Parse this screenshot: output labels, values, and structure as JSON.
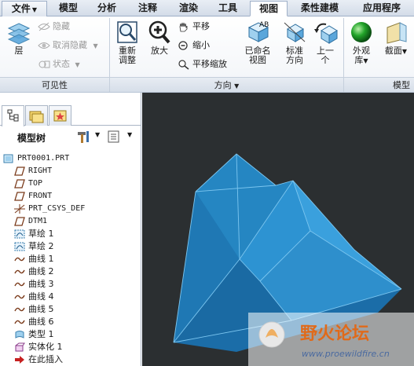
{
  "tabs": {
    "file": "文件",
    "model": "模型",
    "analysis": "分析",
    "annotate": "注释",
    "render": "渲染",
    "tools": "工具",
    "view": "视图",
    "flexible_modeling": "柔性建模",
    "applications": "应用程序"
  },
  "ribbon": {
    "visibility": {
      "layers": "层",
      "hide": "隐藏",
      "unhide": "取消隐藏",
      "status": "状态",
      "group_label": "可见性"
    },
    "orientation": {
      "refit": "重新\n调整",
      "zoom_in": "放大",
      "pan": "平移",
      "zoom_out": "缩小",
      "pan_zoom": "平移缩放",
      "named_views": "已命名\n视图",
      "standard_orientation": "标准\n方向",
      "previous": "上一\n个",
      "group_label": "方向"
    },
    "model_display": {
      "appearance_gallery": "外观\n库",
      "section": "截面",
      "group_label": "模型"
    }
  },
  "panel": {
    "tree_title": "模型树",
    "tree_items": [
      {
        "label": "PRT0001.PRT",
        "icon": "part-icon",
        "mono": true,
        "indent": 0
      },
      {
        "label": "RIGHT",
        "icon": "datum-plane-icon",
        "mono": true,
        "indent": 1
      },
      {
        "label": "TOP",
        "icon": "datum-plane-icon",
        "mono": true,
        "indent": 1
      },
      {
        "label": "FRONT",
        "icon": "datum-plane-icon",
        "mono": true,
        "indent": 1
      },
      {
        "label": "PRT_CSYS_DEF",
        "icon": "csys-icon",
        "mono": true,
        "indent": 1
      },
      {
        "label": "DTM1",
        "icon": "datum-plane-icon",
        "mono": true,
        "indent": 1
      },
      {
        "label": "草绘 1",
        "icon": "sketch-icon",
        "mono": false,
        "indent": 1
      },
      {
        "label": "草绘 2",
        "icon": "sketch-icon",
        "mono": false,
        "indent": 1
      },
      {
        "label": "曲线 1",
        "icon": "curve-icon",
        "mono": false,
        "indent": 1
      },
      {
        "label": "曲线 2",
        "icon": "curve-icon",
        "mono": false,
        "indent": 1
      },
      {
        "label": "曲线 3",
        "icon": "curve-icon",
        "mono": false,
        "indent": 1
      },
      {
        "label": "曲线 4",
        "icon": "curve-icon",
        "mono": false,
        "indent": 1
      },
      {
        "label": "曲线 5",
        "icon": "curve-icon",
        "mono": false,
        "indent": 1
      },
      {
        "label": "曲线 6",
        "icon": "curve-icon",
        "mono": false,
        "indent": 1
      },
      {
        "label": "类型 1",
        "icon": "boundary-blend-icon",
        "mono": false,
        "indent": 1
      },
      {
        "label": "实体化 1",
        "icon": "solidify-icon",
        "mono": false,
        "indent": 1
      },
      {
        "label": "在此插入",
        "icon": "insert-here-arrow-icon",
        "mono": false,
        "indent": 1
      }
    ]
  },
  "watermark": {
    "name": "野火论坛",
    "url": "www.proewildfire.cn"
  },
  "colors": {
    "viewport_bg": "#2b2f31",
    "model_blue": "#2f8fc7",
    "ribbon_accent": "#9fb0c8"
  }
}
